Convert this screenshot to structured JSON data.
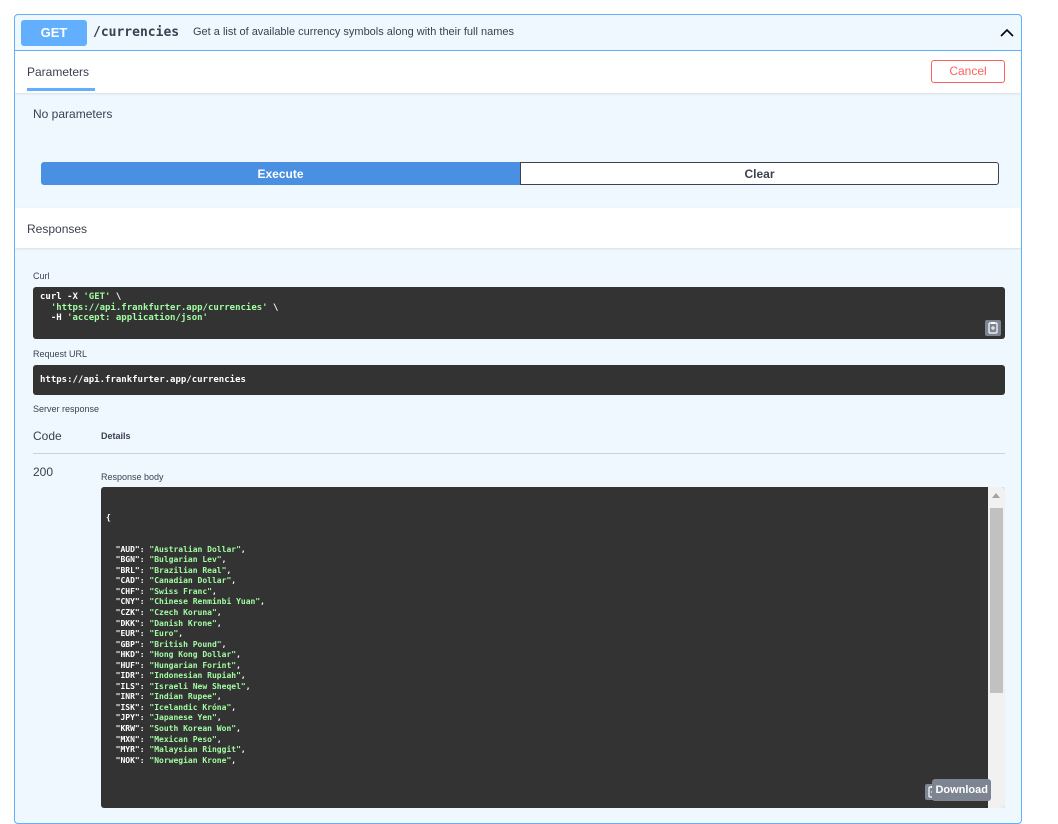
{
  "operation": {
    "method": "GET",
    "path": "/currencies",
    "description": "Get a list of available currency symbols along with their full names"
  },
  "parameters": {
    "tab_label": "Parameters",
    "cancel_label": "Cancel",
    "empty_text": "No parameters"
  },
  "actions": {
    "execute_label": "Execute",
    "clear_label": "Clear"
  },
  "responses": {
    "title": "Responses",
    "curl_label": "Curl",
    "curl": {
      "line1_cmd": "curl -X ",
      "line1_method": "'GET'",
      "line1_tail": " \\",
      "line2_url": "'https://api.frankfurter.app/currencies'",
      "line2_tail": " \\",
      "line3_flag": "  -H ",
      "line3_header": "'accept: application/json'"
    },
    "request_url_label": "Request URL",
    "request_url": "https://api.frankfurter.app/currencies",
    "server_response_label": "Server response",
    "code_header": "Code",
    "details_header": "Details",
    "status_code": "200",
    "response_body_label": "Response body",
    "download_label": "Download",
    "body_open": "{",
    "body_entries": [
      {
        "key": "\"AUD\"",
        "value": "\"Australian Dollar\""
      },
      {
        "key": "\"BGN\"",
        "value": "\"Bulgarian Lev\""
      },
      {
        "key": "\"BRL\"",
        "value": "\"Brazilian Real\""
      },
      {
        "key": "\"CAD\"",
        "value": "\"Canadian Dollar\""
      },
      {
        "key": "\"CHF\"",
        "value": "\"Swiss Franc\""
      },
      {
        "key": "\"CNY\"",
        "value": "\"Chinese Renminbi Yuan\""
      },
      {
        "key": "\"CZK\"",
        "value": "\"Czech Koruna\""
      },
      {
        "key": "\"DKK\"",
        "value": "\"Danish Krone\""
      },
      {
        "key": "\"EUR\"",
        "value": "\"Euro\""
      },
      {
        "key": "\"GBP\"",
        "value": "\"British Pound\""
      },
      {
        "key": "\"HKD\"",
        "value": "\"Hong Kong Dollar\""
      },
      {
        "key": "\"HUF\"",
        "value": "\"Hungarian Forint\""
      },
      {
        "key": "\"IDR\"",
        "value": "\"Indonesian Rupiah\""
      },
      {
        "key": "\"ILS\"",
        "value": "\"Israeli New Sheqel\""
      },
      {
        "key": "\"INR\"",
        "value": "\"Indian Rupee\""
      },
      {
        "key": "\"ISK\"",
        "value": "\"Icelandic Króna\""
      },
      {
        "key": "\"JPY\"",
        "value": "\"Japanese Yen\""
      },
      {
        "key": "\"KRW\"",
        "value": "\"South Korean Won\""
      },
      {
        "key": "\"MXN\"",
        "value": "\"Mexican Peso\""
      },
      {
        "key": "\"MYR\"",
        "value": "\"Malaysian Ringgit\""
      },
      {
        "key": "\"NOK\"",
        "value": "\"Norwegian Krone\""
      }
    ]
  },
  "icons": {
    "collapse": "chevron-up-icon",
    "copy": "clipboard-copy-icon"
  },
  "colors": {
    "get_method": "#61affe",
    "execute": "#4990e2",
    "cancel": "#ff6060",
    "code_bg": "#333333",
    "string": "#a2fca2"
  }
}
